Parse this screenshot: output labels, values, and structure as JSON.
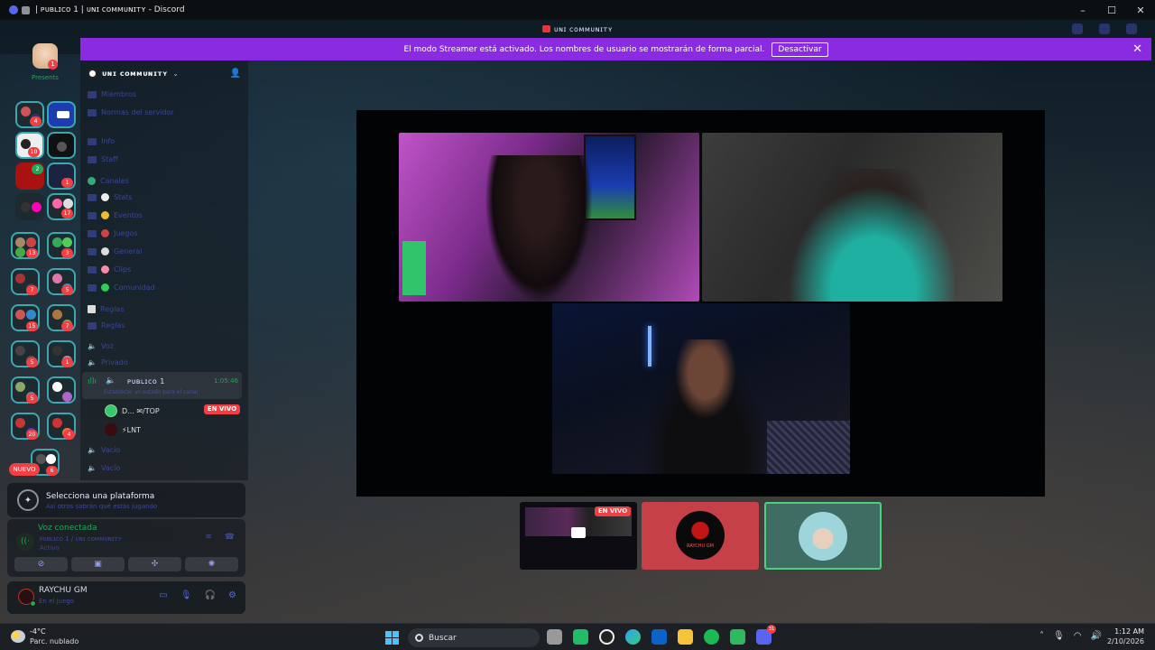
{
  "window": {
    "title": "| ᴘᴜʙʟɪᴄᴏ 1 | ᴜɴɪ ᴄᴏᴍᴍᴜɴɪᴛʏ - Discord",
    "server_title": "ᴜɴɪ ᴄᴏᴍᴍᴜɴɪᴛʏ"
  },
  "streamer_banner": {
    "text": "El modo Streamer está activado. Los nombres de usuario se mostrarán de forma parcial.",
    "button": "Desactivar",
    "close": "✕",
    "color": "#8a2be2"
  },
  "rail": {
    "home_badge": "1",
    "home_label": "Presents",
    "folder_badges": [
      "4",
      "10",
      "2",
      "1",
      "17",
      "13",
      "3",
      "7",
      "5",
      "15",
      "7",
      "5",
      "1",
      "5",
      "20",
      "4",
      "6"
    ],
    "nuevo": "NUEVO"
  },
  "guild": {
    "name": "ᴜɴɪ ᴄᴏᴍᴍᴜɴɪᴛʏ",
    "channels": [
      "Miembros",
      "Normas del servidor",
      "Info",
      "Staff",
      "Canales",
      "Stats",
      "Eventos",
      "Juegos",
      "General",
      "Clips",
      "Comunidad",
      "Reglas",
      "Voz",
      "Privado"
    ]
  },
  "voice_channel": {
    "name": "ᴘᴜʙʟɪᴄᴏ 1",
    "timer": "1:05:46",
    "subtitle": "Establecer un estado para el canal",
    "members": [
      {
        "name": "D... ✉/TOP",
        "live": "EN VIVO"
      },
      {
        "name": "⚡LNT",
        "live": ""
      }
    ],
    "channels_below": [
      "Vacío",
      "Vacío"
    ]
  },
  "platform": {
    "title": "Selecciona una plataforma",
    "subtitle": "Así otros sabrán qué estás jugando"
  },
  "voice_panel": {
    "title": "Voz conectada",
    "sub": "ᴘᴜʙʟɪᴄᴏ 1 / ᴜɴɪ ᴄᴏᴍᴍᴜɴɪᴛʏ",
    "sub2": "Activo"
  },
  "user": {
    "name": "RAYCHU GM",
    "status": "En el juego"
  },
  "stage": {
    "thumb_live": "EN VIVO",
    "thumb_label": "RAYCHU GM"
  },
  "taskbar": {
    "temp": "-4°C",
    "condition": "Parc. nublado",
    "search": "Buscar",
    "discord_badge": "31",
    "time": "1:12 AM",
    "date": "2/10/2026"
  }
}
